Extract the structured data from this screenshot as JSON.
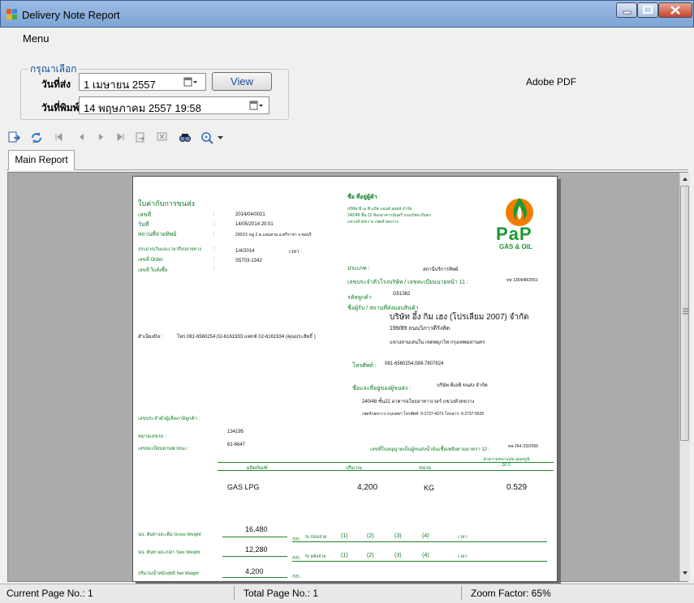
{
  "window": {
    "title": "Delivery Note Report"
  },
  "menu": {
    "label": "Menu"
  },
  "filter": {
    "group_title": "กรุณาเลือก",
    "send_date_label": "วันที่ส่ง",
    "send_date_value": "1  เมษายน    2557",
    "print_date_label": "วันที่พิมพ์",
    "print_date_value": "14 พฤษภาคม  2557   19:58",
    "view_button": "View",
    "adobe_label": "Adobe PDF"
  },
  "toolbar": {
    "icons": [
      "export-icon",
      "refresh-icon",
      "first-page-icon",
      "prev-page-icon",
      "next-page-icon",
      "last-page-icon",
      "goto-page-icon",
      "close-icon",
      "find-icon",
      "zoom-icon"
    ]
  },
  "tabs": [
    {
      "label": "Main Report"
    }
  ],
  "report": {
    "title": "ใบค่ากับการขนส่ง",
    "doc_no_label": "เลขที่",
    "doc_no": "2014/04/0021",
    "date_label": "วันที่",
    "date": "14/05/2014 20:01",
    "location_label": "สถานที่จ่ายทิพย์",
    "location": "2002/1 หมู่ 2 ต.แสนสาม อ.ศรีราชา จ.ชลบุรี",
    "delivery_date_label": "ประมาณวันและเวลาถึงปลายทาง",
    "delivery_date": "1/4/2014",
    "time_label": "เวลา :",
    "order_no_label": "เลขที่ Order",
    "order_no": "S5703-1342",
    "po_no_label": "เลขที่ ใบสั่งซื้อ",
    "seller_name_label": "ชื่อ ที่อยู่ผู้ค้า",
    "seller_name": "บริษัท พี เอ พี แก๊ส แอนด์ ออยล์ จำกัด",
    "seller_addr1": "240/48 ชั้น 22 ห้องอาคารนันทรี ถนนรัชดาภิเษก",
    "seller_addr2": "แขวงห้วยขวาง เขตห้วยขวาง",
    "type_label": "ประเภท :",
    "type": "สถานีบริการทิพย์",
    "tax_label": "เลขประจำตัวโรงบริษัท / เลขทะเบียนนายหน้า 11 :",
    "tax_no": "ทพ 1354/48/2551",
    "customer_code_label": "รหัสลูกค้า",
    "customer_code": "G51362",
    "receiver_label": "ชื่อผู้รับ / สถานที่ส่งมอบสินค้า",
    "receiver_name": "บริษัท อึ้ง กิม เฮง (โปรเลียม 2007) จำกัด",
    "receiver_addr1": "199/89 ถนนวิภาวดีรังสิต",
    "receiver_addr2": "แขวงสามเสนใน เขตพญาไท กรุงเทพมหานคร",
    "phone_label": "โทรศัพท์ :",
    "phone": "081-6560254,089-7807824",
    "note_label": "สำเนียงบิล :",
    "note": "โทร.081-6560254,02-6161933 แฟกซ์ 02-6161934 (คุณประสิทธิ์ )",
    "transport_label": "ชื่อและที่อยู่ของผู้ขนส่ง :",
    "transport_name": "บริษัท พีเอพี ขนส่ง จำกัด",
    "transport_addr1": "240/48 ชั้น22 อาคารอโยธยาทาวเวอร์ แขวงห้วยขวาง",
    "transport_addr2": "เขตห้วยขวาง กรุงเทพฯ โทรศัพท์: 0-2737-4373 โทรสาร: 0-2737-5535",
    "id_label": "เลขประจำตัวผู้เสียภาษีลูกค้า :",
    "vehicle_label": "หมายเลขรถ :",
    "vehicle_no": "134195",
    "plate_label": "เลขทะเบียนยานพาหนะ :",
    "plate_no": "61-6647",
    "permit_label": "เลขที่ใบอนุญาตเป็นผู้ขนส่งน้ำมันเชื้อเพลิงตามมาตรา 12 :",
    "permit_no": "ทพ 264 /15/2555",
    "table": {
      "headers": [
        "ผลิตภัณฑ์",
        "ปริมาณ",
        "หน่วย",
        "ค่าความหนาแน่น อุณหภูมิ 30 C"
      ],
      "row": [
        "GAS LPG",
        "4,200",
        "KG",
        "0.529"
      ]
    },
    "gross_label": "นน. ตันทางสะเต็ม Gross Weight",
    "gross": "16,480",
    "tare_label": "นน. ตันทางสะเปล่า Tare Weight",
    "tare": "12,280",
    "net_label": "ปริมาณน้ำหนักสุทธิ Net Weight",
    "net": "4,200",
    "unit": "กก.",
    "before_label": "% ก่อนจ่าย",
    "after_label": "% หลังจ่าย",
    "checks": [
      "(1)",
      "(2)",
      "(3)",
      "(4)"
    ],
    "time2_label": "เวลา",
    "logo_text": "PaP",
    "logo_sub": "GAS & OIL"
  },
  "status": {
    "current_page": "Current Page No.: 1",
    "total_page": "Total Page No.: 1",
    "zoom": "Zoom Factor: 65%"
  },
  "colors": {
    "green": "#0a7a1f",
    "orange": "#f07d00",
    "link_blue": "#0a50a0"
  }
}
